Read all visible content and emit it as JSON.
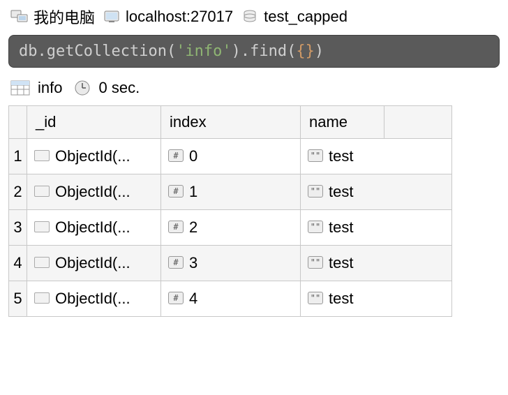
{
  "breadcrumb": {
    "host_label": "我的电脑",
    "server_label": "localhost:27017",
    "db_label": "test_capped"
  },
  "query": {
    "prefix": "db",
    "method1": "getCollection",
    "arg_str": "'info'",
    "method2": "find",
    "arg_obj": "{}"
  },
  "tab": {
    "name": "info",
    "timing": "0 sec."
  },
  "columns": {
    "id": "_id",
    "index": "index",
    "name": "name"
  },
  "rows": [
    {
      "n": "1",
      "id": "ObjectId(...",
      "index": "0",
      "name": "test"
    },
    {
      "n": "2",
      "id": "ObjectId(...",
      "index": "1",
      "name": "test"
    },
    {
      "n": "3",
      "id": "ObjectId(...",
      "index": "2",
      "name": "test"
    },
    {
      "n": "4",
      "id": "ObjectId(...",
      "index": "3",
      "name": "test"
    },
    {
      "n": "5",
      "id": "ObjectId(...",
      "index": "4",
      "name": "test"
    }
  ]
}
